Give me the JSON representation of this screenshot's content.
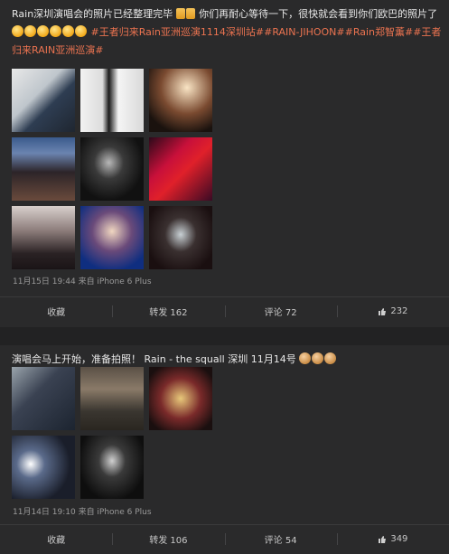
{
  "posts": [
    {
      "text_main": "Rain深圳演唱会的照片已经整理完毕",
      "text_mid": "你们再耐心等待一下，很快就会看到你们欧巴的照片了",
      "hashtags": "#王者归来Rain亚洲巡演1114深圳站##RAIN-JIHOON##Rain郑智薰##王者归来RAIN亚洲巡演#",
      "meta": "11月15日 19:44 来自 iPhone 6 Plus",
      "actions": {
        "favorite": "收藏",
        "repost": "转发 162",
        "comment": "评论 72",
        "like": "232"
      }
    },
    {
      "text_main": "演唱会马上开始，准备拍照！ Rain - the squall 深圳 11月14号",
      "meta": "11月14日 19:10 来自 iPhone 6 Plus",
      "actions": {
        "favorite": "收藏",
        "repost": "转发 106",
        "comment": "评论 54",
        "like": "349"
      }
    }
  ],
  "icons": {
    "like": "thumbs-up-icon",
    "emoji": "emoji-icon"
  },
  "colors": {
    "hashtag": "#eb7350",
    "background": "#2a2a2b"
  }
}
